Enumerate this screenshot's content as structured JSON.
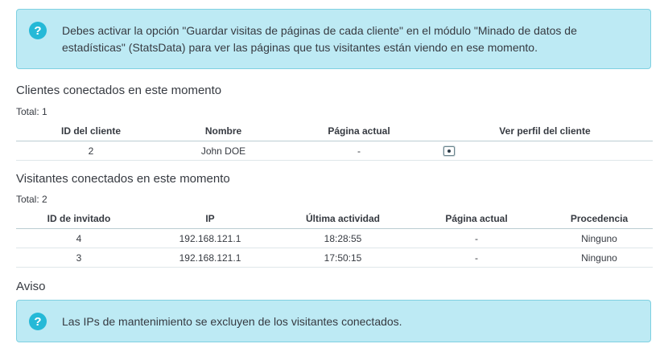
{
  "alert_top": {
    "icon": "question-circle-icon",
    "text": "Debes activar la opción \"Guardar visitas de páginas de cada cliente\" en el módulo \"Minado de datos de estadísticas\" (StatsData) para ver las páginas que tus visitantes están viendo en ese momento."
  },
  "customers": {
    "heading": "Clientes conectados en este momento",
    "total": "Total: 1",
    "columns": [
      "ID del cliente",
      "Nombre",
      "Página actual",
      "Ver perfil del cliente"
    ],
    "rows": [
      {
        "id": "2",
        "name": "John DOE",
        "page": "-",
        "profile_icon": "view-icon"
      }
    ]
  },
  "visitors": {
    "heading": "Visitantes conectados en este momento",
    "total": "Total: 2",
    "columns": [
      "ID de invitado",
      "IP",
      "Última actividad",
      "Página actual",
      "Procedencia"
    ],
    "rows": [
      {
        "id": "4",
        "ip": "192.168.121.1",
        "last": "18:28:55",
        "page": "-",
        "origin": "Ninguno"
      },
      {
        "id": "3",
        "ip": "192.168.121.1",
        "last": "17:50:15",
        "page": "-",
        "origin": "Ninguno"
      }
    ]
  },
  "notice": {
    "heading": "Aviso",
    "text": "Las IPs de mantenimiento se excluyen de los visitantes conectados.",
    "icon": "question-circle-icon"
  },
  "colors": {
    "info_bg": "#bdeaf4",
    "info_border": "#7fd0e1",
    "accent": "#25b9d7"
  }
}
